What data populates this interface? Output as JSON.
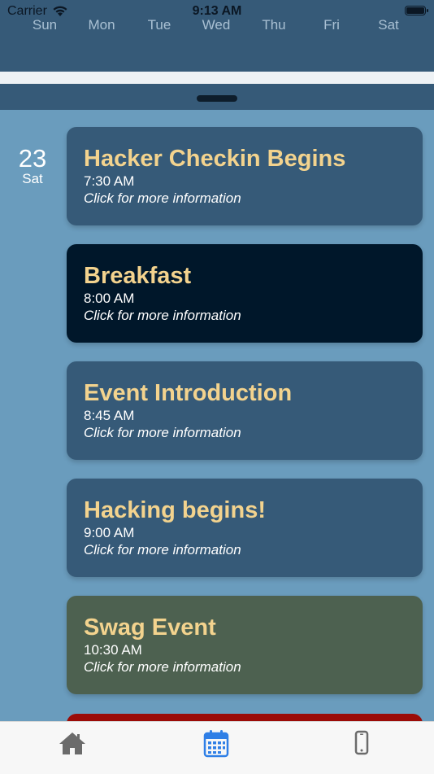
{
  "status_bar": {
    "carrier": "Carrier",
    "time": "9:13 AM"
  },
  "week": {
    "days": [
      "Sun",
      "Mon",
      "Tue",
      "Wed",
      "Thu",
      "Fri",
      "Sat"
    ]
  },
  "date": {
    "number": "23",
    "weekday": "Sat"
  },
  "events": [
    {
      "title": "Hacker Checkin Begins",
      "time": "7:30 AM",
      "info": "Click for more information",
      "color": "#365a78"
    },
    {
      "title": "Breakfast",
      "time": "8:00 AM",
      "info": "Click for more information",
      "color": "#00172a"
    },
    {
      "title": "Event Introduction",
      "time": "8:45 AM",
      "info": "Click for more information",
      "color": "#365a78"
    },
    {
      "title": "Hacking begins!",
      "time": "9:00 AM",
      "info": "Click for more information",
      "color": "#365a78"
    },
    {
      "title": "Swag Event",
      "time": "10:30 AM",
      "info": "Click for more information",
      "color": "#4d6150"
    }
  ],
  "colors": {
    "header": "#365a78",
    "background": "#6a9cbd",
    "title": "#f3d38e",
    "partial_card": "#9b0b07",
    "tab_active": "#2f7fe6",
    "tab_inactive": "#6b6b6b"
  },
  "tabs": [
    {
      "icon": "house-icon",
      "active": false
    },
    {
      "icon": "calendar-icon",
      "active": true
    },
    {
      "icon": "phone-icon",
      "active": false
    }
  ]
}
